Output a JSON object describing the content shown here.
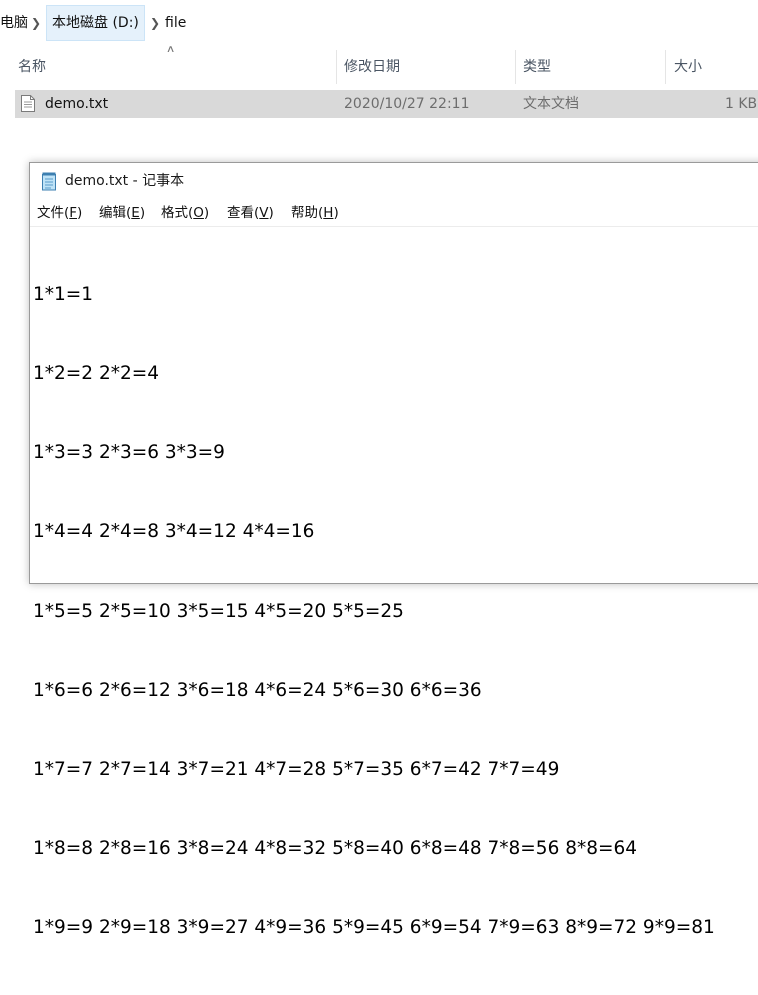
{
  "explorer": {
    "breadcrumb": [
      "电脑",
      "本地磁盘 (D:)",
      "file"
    ],
    "columns": [
      "名称",
      "修改日期",
      "类型",
      "大小"
    ],
    "files": [
      {
        "name": "demo.txt",
        "modified": "2020/10/27 22:11",
        "type": "文本文档",
        "size": "1 KB"
      }
    ]
  },
  "notepad": {
    "title": "demo.txt - 记事本",
    "menu": [
      {
        "label": "文件(",
        "key": "F",
        "close": ")"
      },
      {
        "label": "编辑(",
        "key": "E",
        "close": ")"
      },
      {
        "label": "格式(",
        "key": "O",
        "close": ")"
      },
      {
        "label": "查看(",
        "key": "V",
        "close": ")"
      },
      {
        "label": "帮助(",
        "key": "H",
        "close": ")"
      }
    ],
    "lines": [
      "1*1=1",
      "1*2=2 2*2=4",
      "1*3=3 2*3=6 3*3=9",
      "1*4=4 2*4=8 3*4=12 4*4=16",
      "1*5=5 2*5=10 3*5=15 4*5=20 5*5=25",
      "1*6=6 2*6=12 3*6=18 4*6=24 5*6=30 6*6=36",
      "1*7=7 2*7=14 3*7=21 4*7=28 5*7=35 6*7=42 7*7=49",
      "1*8=8 2*8=16 3*8=24 4*8=32 5*8=40 6*8=48 7*8=56 8*8=64",
      "1*9=9 2*9=18 3*9=27 4*9=36 5*9=45 6*9=54 7*9=63 8*9=72 9*9=81"
    ]
  }
}
